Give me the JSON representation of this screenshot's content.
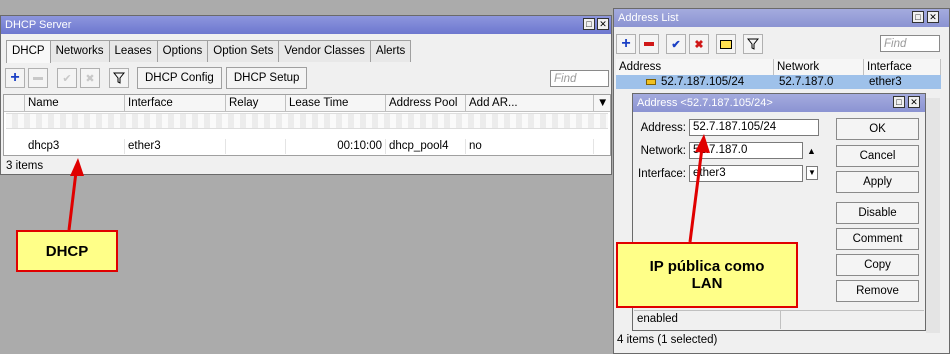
{
  "dhcp_window": {
    "title": "DHCP Server",
    "tabs": [
      "DHCP",
      "Networks",
      "Leases",
      "Options",
      "Option Sets",
      "Vendor Classes",
      "Alerts"
    ],
    "config_button": "DHCP Config",
    "setup_button": "DHCP Setup",
    "find_placeholder": "Find",
    "columns": [
      "Name",
      "Interface",
      "Relay",
      "Lease Time",
      "Address Pool",
      "Add AR..."
    ],
    "row": {
      "name": "dhcp3",
      "interface": "ether3",
      "relay": "",
      "lease_time": "00:10:00",
      "address_pool": "dhcp_pool4",
      "add_arp": "no"
    },
    "status": "3 items"
  },
  "address_list": {
    "title": "Address List",
    "find_placeholder": "Find",
    "columns": [
      "Address",
      "Network",
      "Interface"
    ],
    "row": {
      "address": "52.7.187.105/24",
      "network": "52.7.187.0",
      "interface": "ether3"
    },
    "status": "4 items (1 selected)"
  },
  "address_dialog": {
    "title": "Address <52.7.187.105/24>",
    "address_label": "Address:",
    "address_value": "52.7.187.105/24",
    "network_label": "Network:",
    "network_value": "52.7.187.0",
    "interface_label": "Interface:",
    "interface_value": "ether3",
    "buttons": {
      "ok": "OK",
      "cancel": "Cancel",
      "apply": "Apply",
      "disable": "Disable",
      "comment": "Comment",
      "copy": "Copy",
      "remove": "Remove"
    },
    "status": "enabled"
  },
  "callouts": {
    "dhcp": "DHCP",
    "ip_line1": "IP pública como",
    "ip_line2": "LAN"
  },
  "colors": {
    "title_bar": "#7880d4",
    "selection": "#9ec1ea",
    "callout_fill": "#ffff88",
    "callout_border": "#e00000"
  }
}
